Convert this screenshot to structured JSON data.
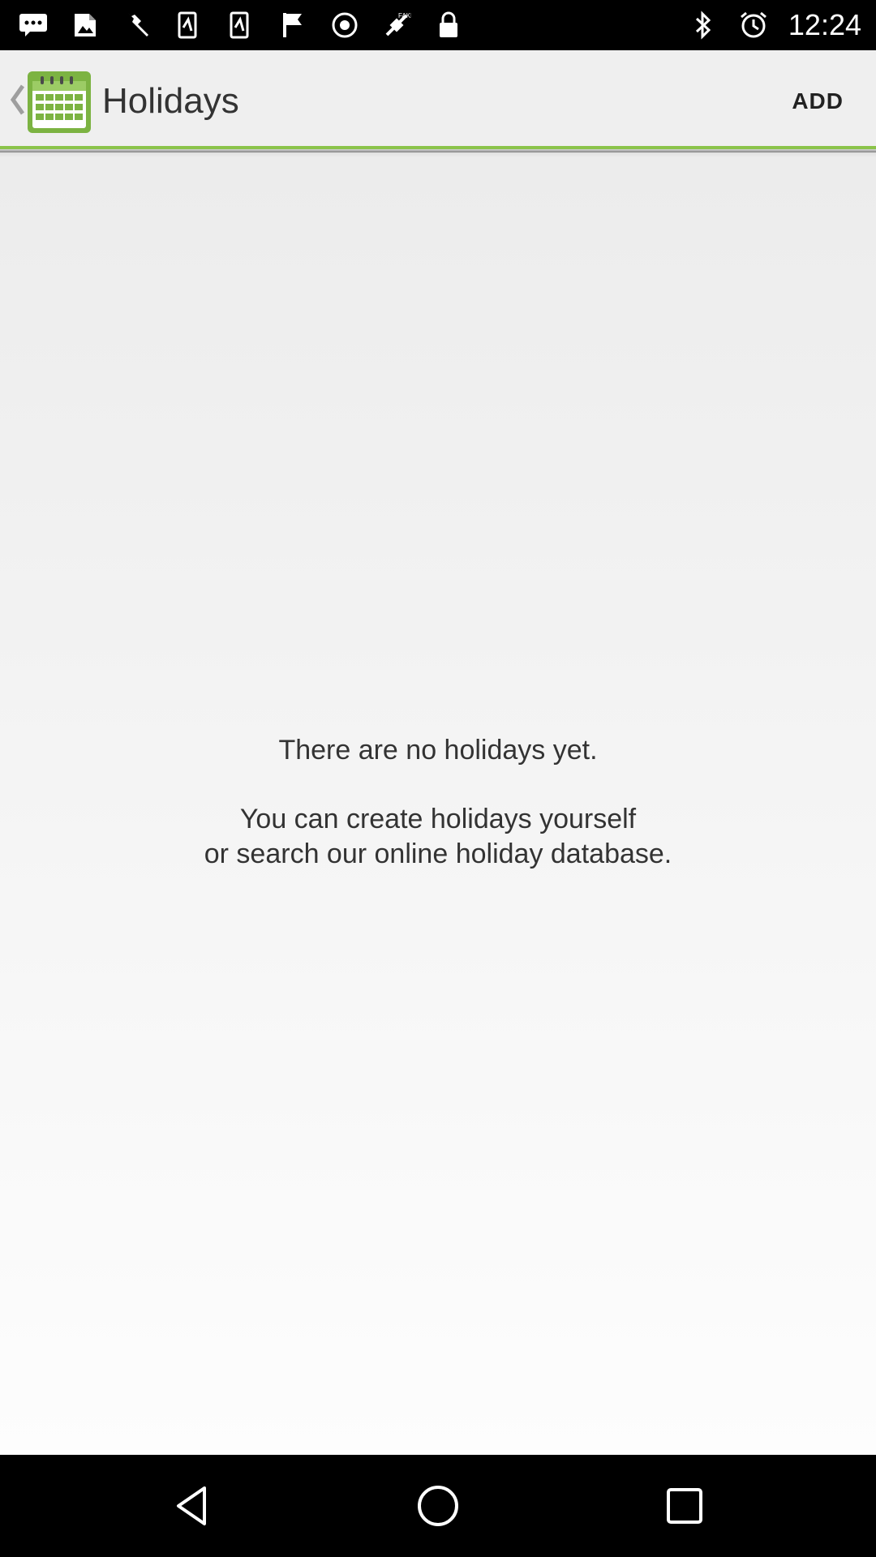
{
  "status_bar": {
    "time": "12:24",
    "icons_left": [
      "message-icon",
      "image-icon",
      "wrench-icon",
      "phone-signal-icon",
      "phone-signal-icon",
      "flag-icon",
      "sync-icon",
      "fake-gps-icon",
      "lock-icon"
    ],
    "icons_right": [
      "bluetooth-icon",
      "alarm-icon"
    ]
  },
  "action_bar": {
    "title": "Holidays",
    "add_label": "ADD",
    "accent_color": "#8bc34a"
  },
  "empty_state": {
    "line1": "There are no holidays yet.",
    "line2": "You can create holidays yourself",
    "line3": "or search our online holiday database."
  },
  "nav_bar": {
    "buttons": [
      "back-icon",
      "home-icon",
      "recents-icon"
    ]
  }
}
